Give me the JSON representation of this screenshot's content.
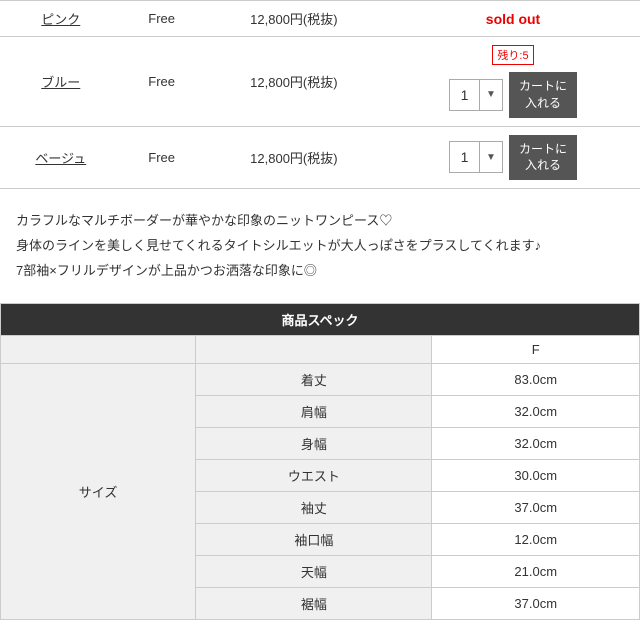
{
  "variants": [
    {
      "name": "ピンク",
      "size": "Free",
      "price": "12,800円(税抜)",
      "status": "sold_out",
      "sold_out_label": "sold out",
      "remaining": null,
      "qty": null
    },
    {
      "name": "ブルー",
      "size": "Free",
      "price": "12,800円(税抜)",
      "status": "available",
      "remaining_label": "残り:5",
      "qty": "1",
      "add_to_cart": "カートに\n入れる"
    },
    {
      "name": "ベージュ",
      "size": "Free",
      "price": "12,800円(税抜)",
      "status": "available",
      "remaining_label": null,
      "qty": "1",
      "add_to_cart": "カートに\n入れる"
    }
  ],
  "description": "カラフルなマルチボーダーが華やかな印象のニットワンピース♡\n身体のラインを美しく見せてくれるタイトシルエットが大人っぽさをプラスしてくれます♪\n7部袖×フリルデザインが上品かつお洒落な印象に◎",
  "spec": {
    "section_title": "商品スペック",
    "size_label": "サイズ",
    "col_f": "F",
    "rows": [
      {
        "label": "着丈",
        "value": "83.0cm"
      },
      {
        "label": "肩幅",
        "value": "32.0cm"
      },
      {
        "label": "身幅",
        "value": "32.0cm"
      },
      {
        "label": "ウエスト",
        "value": "30.0cm"
      },
      {
        "label": "袖丈",
        "value": "37.0cm"
      },
      {
        "label": "袖口幅",
        "value": "12.0cm"
      },
      {
        "label": "天幅",
        "value": "21.0cm"
      },
      {
        "label": "裾幅",
        "value": "37.0cm"
      }
    ]
  }
}
